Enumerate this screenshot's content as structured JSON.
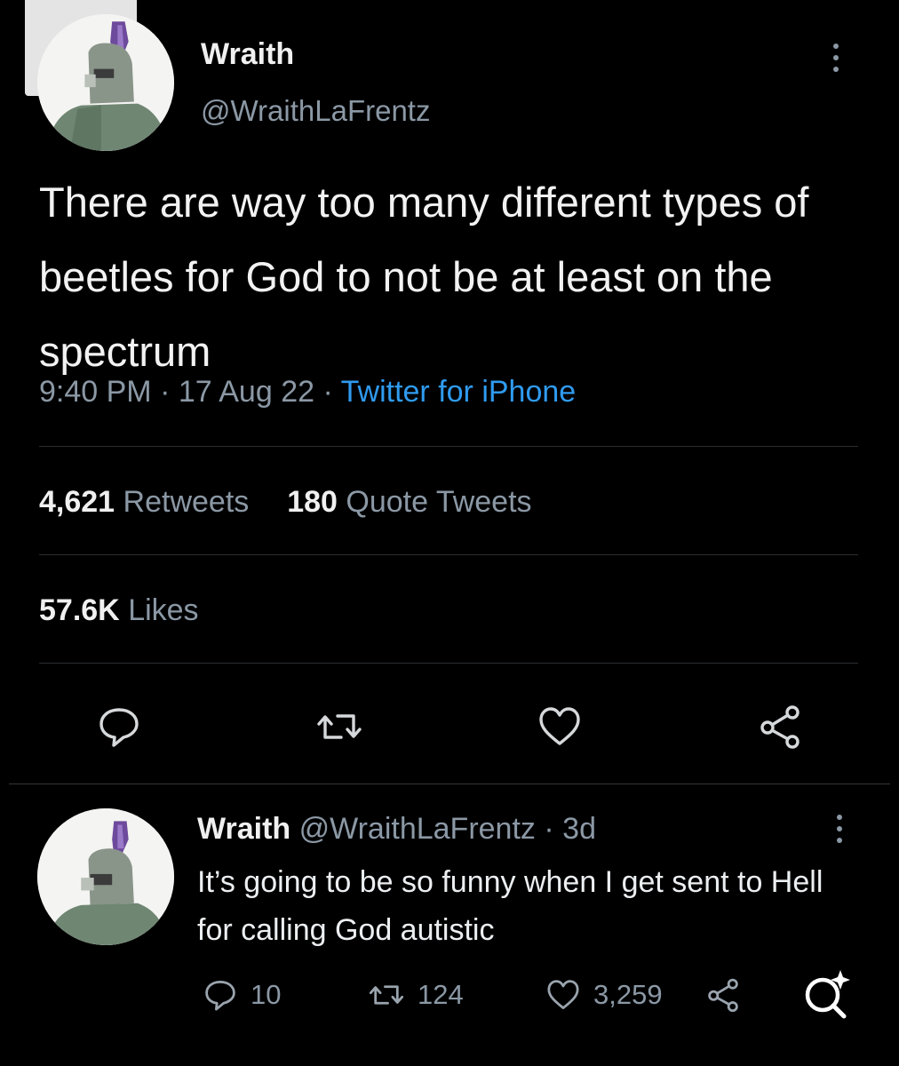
{
  "tweet": {
    "author_name": "Wraith",
    "author_handle": "@WraithLaFrentz",
    "text": "There are way too many different types of beetles for God to not be at least on the spectrum",
    "time": "9:40 PM",
    "date": "17 Aug 22",
    "source": "Twitter for iPhone",
    "retweets_count": "4,621",
    "retweets_label": "Retweets",
    "quotes_count": "180",
    "quotes_label": "Quote Tweets",
    "likes_count": "57.6K",
    "likes_label": "Likes"
  },
  "reply": {
    "author_name": "Wraith",
    "author_handle": "@WraithLaFrentz",
    "age": "3d",
    "text": "It’s going to be so funny when I get sent to Hell for calling God autistic",
    "replies": "10",
    "retweets": "124",
    "likes": "3,259"
  },
  "icons": {
    "back": "chevron-left-icon",
    "more": "more-vertical-icon",
    "reply": "comment-icon",
    "retweet": "retweet-icon",
    "like": "heart-icon",
    "share": "share-icon",
    "lens": "visual-search-icon"
  },
  "colors": {
    "background": "#000000",
    "text": "#e7e9ea",
    "secondary": "#8b98a5",
    "link": "#2f9bf0",
    "divider": "#2a2d30"
  }
}
